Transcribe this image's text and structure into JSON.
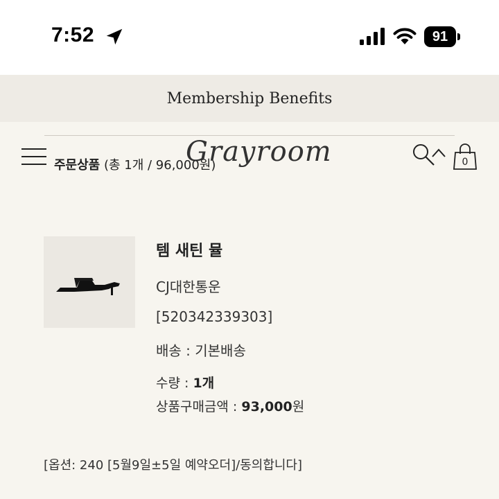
{
  "status_bar": {
    "time": "7:52",
    "battery_level": "91",
    "icons": [
      "location-arrow-icon",
      "cellular-signal-icon",
      "wifi-icon",
      "battery-icon"
    ]
  },
  "banner": {
    "text": "Membership Benefits"
  },
  "header": {
    "order_label": "주문상품",
    "order_summary": "(총 1개 / 96,000원)",
    "logo_text": "Grayroom",
    "cart_count": "0",
    "icons": [
      "menu-icon",
      "search-icon",
      "chevron-up-icon",
      "shopping-bag-icon"
    ]
  },
  "product": {
    "name": "템 새틴 뮬",
    "courier": "CJ대한통운",
    "tracking_number": "[520342339303]",
    "shipping": "배송 : 기본배송",
    "quantity_label": "수량 : ",
    "quantity_value": "1개",
    "price_label": "상품구매금액 : ",
    "price_value": "93,000",
    "price_unit": "원",
    "option": "[옵션: 240 [5월9일±5일 예약오더]/동의합니다]"
  },
  "colors": {
    "page_background": "#f7f5ef",
    "banner_background": "#eeebe5",
    "text": "#222222"
  }
}
